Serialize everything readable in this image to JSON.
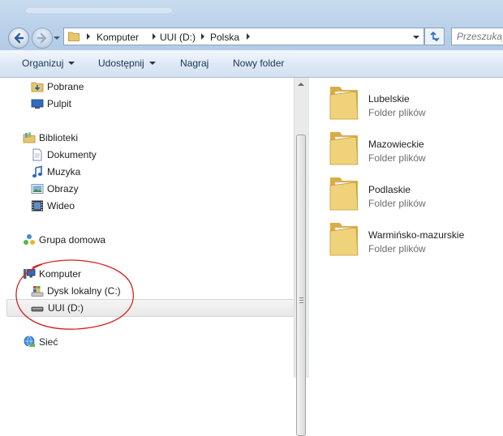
{
  "address": {
    "crumbs": [
      "Komputer",
      "UUI (D:)",
      "Polska"
    ],
    "search_placeholder": "Przeszukaj: Polska"
  },
  "toolbar": {
    "organize": "Organizuj",
    "share": "Udostępnij",
    "burn": "Nagraj",
    "new_folder": "Nowy folder"
  },
  "nav": {
    "downloads": "Pobrane",
    "desktop": "Pulpit",
    "libraries": "Biblioteki",
    "documents": "Dokumenty",
    "music": "Muzyka",
    "pictures": "Obrazy",
    "videos": "Wideo",
    "homegroup": "Grupa domowa",
    "computer": "Komputer",
    "local_disk": "Dysk lokalny (C:)",
    "drive_d": "UUI (D:)",
    "network": "Sieć"
  },
  "content": {
    "items": [
      {
        "name": "Lubelskie",
        "type": "Folder plików"
      },
      {
        "name": "Mazowieckie",
        "type": "Folder plików"
      },
      {
        "name": "Podlaskie",
        "type": "Folder plików"
      },
      {
        "name": "Warmińsko-mazurskie",
        "type": "Folder plików"
      }
    ]
  },
  "colors": {
    "annotation": "#d42020",
    "folder": "#e9c66c",
    "command_text": "#1b3557"
  }
}
